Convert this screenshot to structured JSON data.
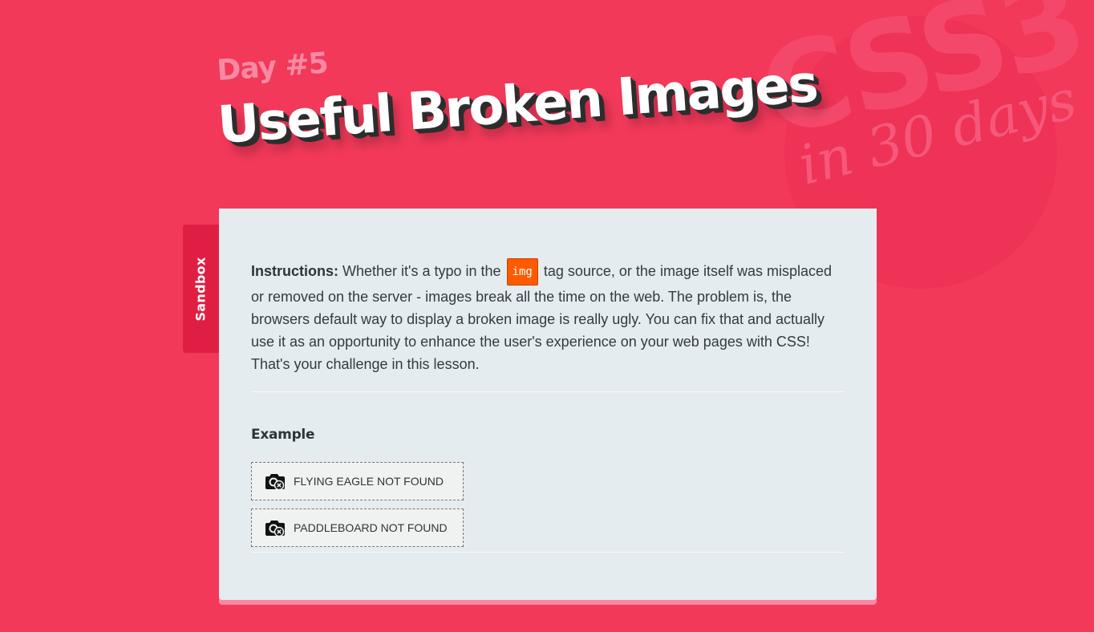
{
  "background": {
    "logo_main": "CSS3",
    "logo_sub": "in 30 days",
    "color": "#f2395a"
  },
  "header": {
    "day_label": "Day #5",
    "title": "Useful Broken Images"
  },
  "sidebar": {
    "tab_label": "Sandbox"
  },
  "card": {
    "instructions_label": "Instructions:",
    "instructions_before": " Whether it's a typo in the ",
    "code_tag": "img",
    "instructions_after": " tag source, or the image itself was misplaced or removed on the server - images break all the time on the web. The problem is, the browsers default way to display a broken image is really ugly. You can fix that and actually use it as an opportunity to enhance the user's experience on your web pages with CSS! That's your challenge in this lesson.",
    "example_heading": "Example",
    "examples": [
      {
        "label": "Flying eagle not found",
        "icon": "broken-camera-icon"
      },
      {
        "label": "Paddleboard not found",
        "icon": "broken-camera-icon"
      }
    ]
  },
  "colors": {
    "accent": "#ff5a00",
    "tab": "#e01e44",
    "card": "#e5ecef"
  }
}
